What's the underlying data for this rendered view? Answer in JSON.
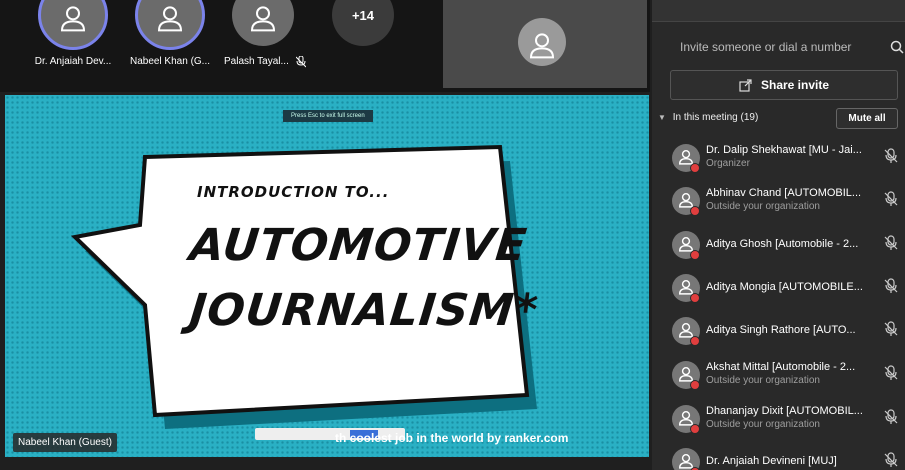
{
  "top_strip": {
    "tiles": [
      {
        "name": "Dr. Anjaiah Dev..."
      },
      {
        "name": "Nabeel Khan (G..."
      },
      {
        "name": "Palash Tayal..."
      }
    ],
    "more_count": "+14"
  },
  "screen": {
    "exit_hint": "Press Esc to exit full screen",
    "slide": {
      "intro": "INTRODUCTION TO...",
      "title_line1": "AUTOMOTIVE",
      "title_line2": "JOURNALISM*",
      "caption": "th coolest job in the world by ranker.com"
    },
    "speaker_tag": "Nabeel Khan (Guest)"
  },
  "panel": {
    "invite_placeholder": "Invite someone or dial a number",
    "share_invite": "Share invite",
    "in_meeting_label": "In this meeting (19)",
    "mute_all": "Mute all",
    "participants": [
      {
        "name": "Dr. Dalip Shekhawat [MU - Jai...",
        "sub": "Organizer"
      },
      {
        "name": "Abhinav Chand [AUTOMOBIL...",
        "sub": "Outside your organization"
      },
      {
        "name": "Aditya Ghosh [Automobile - 2...",
        "sub": ""
      },
      {
        "name": "Aditya Mongia [AUTOMOBILE...",
        "sub": ""
      },
      {
        "name": "Aditya Singh Rathore [AUTO...",
        "sub": ""
      },
      {
        "name": "Akshat Mittal [Automobile - 2...",
        "sub": "Outside your organization"
      },
      {
        "name": "Dhananjay Dixit [AUTOMOBIL...",
        "sub": "Outside your organization"
      },
      {
        "name": "Dr. Anjaiah Devineni [MUJ]",
        "sub": ""
      }
    ]
  }
}
